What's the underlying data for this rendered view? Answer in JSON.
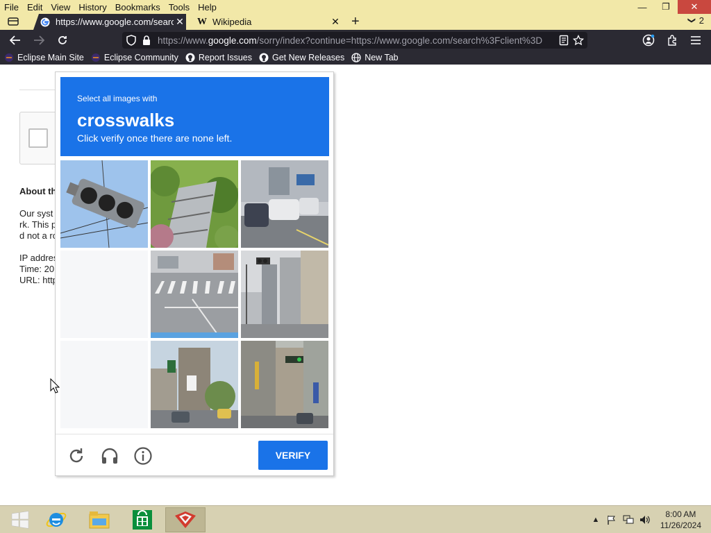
{
  "menu": [
    "File",
    "Edit",
    "View",
    "History",
    "Bookmarks",
    "Tools",
    "Help"
  ],
  "window_controls": {
    "minimize": "—",
    "restore": "❐",
    "close": "✕"
  },
  "tabs": [
    {
      "title": "https://www.google.com/searcl",
      "active": true,
      "icon": "google-icon"
    },
    {
      "title": "Wikipedia",
      "active": false,
      "icon": "wikipedia-icon"
    }
  ],
  "new_tab_symbol": "+",
  "tab_overflow": {
    "chevron": "❯",
    "count": "2"
  },
  "urlbar": {
    "prefix": "https://www.",
    "domain": "google.com",
    "path": "/sorry/index?continue=https://www.google.com/search%3Fclient%3D"
  },
  "bookmarks": [
    {
      "label": "Eclipse Main Site",
      "icon": "eclipse-icon"
    },
    {
      "label": "Eclipse Community",
      "icon": "eclipse-icon"
    },
    {
      "label": "Report Issues",
      "icon": "github-icon"
    },
    {
      "label": "Get New Releases",
      "icon": "github-icon"
    },
    {
      "label": "New Tab",
      "icon": "globe-icon"
    }
  ],
  "page": {
    "about_heading": "About th",
    "para1": [
      "Our syst",
      "rk. This p",
      "d not a ro"
    ],
    "para2": [
      "IP addres",
      "Time: 20",
      "URL: http"
    ]
  },
  "challenge": {
    "instruction": "Select all images with",
    "target": "crosswalks",
    "hint": "Click verify once there are none left.",
    "tiles": [
      {
        "content": "traffic-light",
        "empty": false
      },
      {
        "content": "stairs-greenery",
        "empty": false
      },
      {
        "content": "street-cars",
        "empty": false
      },
      {
        "content": "",
        "empty": true
      },
      {
        "content": "crosswalk",
        "empty": false
      },
      {
        "content": "street-buildings-traffic-light",
        "empty": false
      },
      {
        "content": "",
        "empty": true
      },
      {
        "content": "intersection-traffic-light",
        "empty": false
      },
      {
        "content": "street-shops-traffic-light",
        "empty": false
      }
    ],
    "verify_label": "VERIFY"
  },
  "taskbar": {
    "apps": [
      "windows-start-icon",
      "internet-explorer-icon",
      "file-explorer-icon",
      "store-icon",
      "app-icon"
    ],
    "clock_time": "8:00 AM",
    "clock_date": "11/26/2024"
  }
}
